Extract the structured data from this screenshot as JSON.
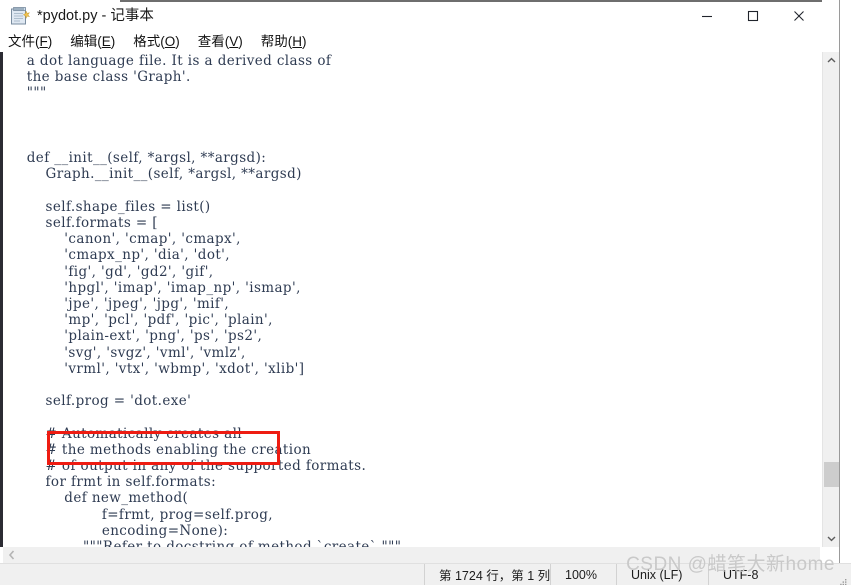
{
  "window": {
    "title": "*pydot.py - 记事本",
    "icon": "notepad-icon",
    "minimize_label": "—",
    "maximize_label": "□",
    "close_label": "✕"
  },
  "menubar": {
    "items": [
      {
        "label": "文件(F)",
        "text": "文件",
        "mnemonic": "F"
      },
      {
        "label": "编辑(E)",
        "text": "编辑",
        "mnemonic": "E"
      },
      {
        "label": "格式(O)",
        "text": "格式",
        "mnemonic": "O"
      },
      {
        "label": "查看(V)",
        "text": "查看",
        "mnemonic": "V"
      },
      {
        "label": "帮助(H)",
        "text": "帮助",
        "mnemonic": "H"
      }
    ]
  },
  "editor": {
    "content": "    a dot language file. It is a derived class of\n    the base class 'Graph'.\n    \"\"\"\n\n\n\n    def __init__(self, *argsl, **argsd):\n        Graph.__init__(self, *argsl, **argsd)\n\n        self.shape_files = list()\n        self.formats = [\n            'canon', 'cmap', 'cmapx',\n            'cmapx_np', 'dia', 'dot',\n            'fig', 'gd', 'gd2', 'gif',\n            'hpgl', 'imap', 'imap_np', 'ismap',\n            'jpe', 'jpeg', 'jpg', 'mif',\n            'mp', 'pcl', 'pdf', 'pic', 'plain',\n            'plain-ext', 'png', 'ps', 'ps2',\n            'svg', 'svgz', 'vml', 'vmlz',\n            'vrml', 'vtx', 'wbmp', 'xdot', 'xlib']\n\n        self.prog = 'dot.exe'\n\n        # Automatically creates all\n        # the methods enabling the creation\n        # of output in any of the supported formats.\n        for frmt in self.formats:\n            def new_method(\n                    f=frmt, prog=self.prog,\n                    encoding=None):\n                \"\"\"Refer to docstring of method `create`.\"\"\"",
    "highlight": {
      "text": "self.prog = 'dot.exe'",
      "color": "#ee1c12"
    },
    "text_color": "#2e3b52"
  },
  "scrollbars": {
    "vertical": {
      "up_arrow": "▲",
      "down_arrow": "▼"
    },
    "horizontal": {
      "left_arrow": "◀"
    }
  },
  "statusbar": {
    "position": "第 1724 行，第 1 列",
    "zoom": "100%",
    "line_ending": "Unix (LF)",
    "encoding": "UTF-8"
  },
  "watermark": {
    "text": "CSDN @蜡笔大新home"
  }
}
